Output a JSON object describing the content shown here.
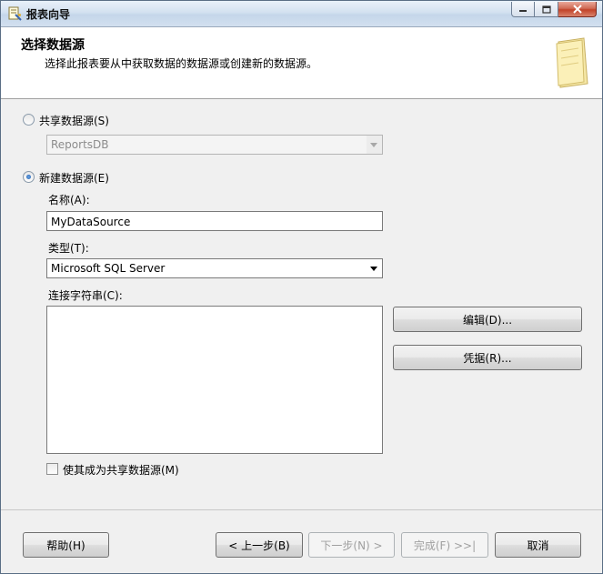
{
  "window": {
    "title": "报表向导"
  },
  "header": {
    "title": "选择数据源",
    "subtitle": "选择此报表要从中获取数据的数据源或创建新的数据源。"
  },
  "shared_source": {
    "radio_label": "共享数据源(S)",
    "selected_value": "ReportsDB",
    "checked": false
  },
  "new_source": {
    "radio_label": "新建数据源(E)",
    "checked": true,
    "name_label": "名称(A):",
    "name_value": "MyDataSource",
    "type_label": "类型(T):",
    "type_value": "Microsoft SQL Server",
    "conn_label": "连接字符串(C):",
    "conn_value": "",
    "edit_button": "编辑(D)...",
    "credentials_button": "凭据(R)...",
    "make_shared_label": "使其成为共享数据源(M)",
    "make_shared_checked": false
  },
  "footer": {
    "help": "帮助(H)",
    "back": "< 上一步(B)",
    "next": "下一步(N) >",
    "finish": "完成(F) >>|",
    "cancel": "取消"
  },
  "colors": {
    "accent": "#1d5fb5",
    "close": "#c24329"
  },
  "icons": {
    "title": "report-wizard-icon",
    "header": "notepad-icon"
  }
}
